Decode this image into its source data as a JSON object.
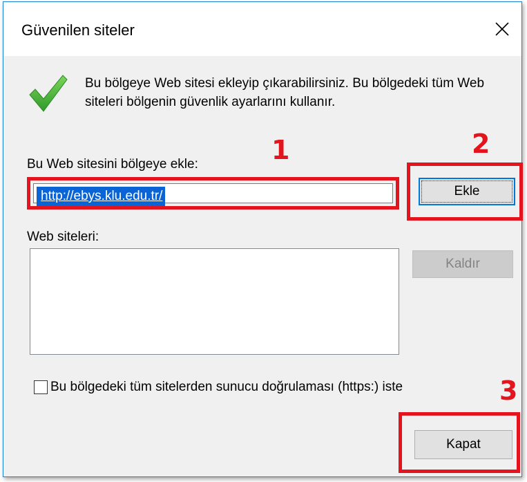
{
  "dialog": {
    "title": "Güvenilen siteler",
    "info": "Bu bölgeye Web sitesi ekleyip çıkarabilirsiniz. Bu bölgedeki tüm Web siteleri bölgenin güvenlik ayarlarını kullanır.",
    "add_label": "Bu Web sitesini bölgeye ekle:",
    "url_value": "http://ebys.klu.edu.tr/",
    "add_button": "Ekle",
    "sites_label": "Web siteleri:",
    "remove_button": "Kaldır",
    "https_checkbox_label": "Bu bölgedeki tüm sitelerden sunucu doğrulaması (https:) iste",
    "https_checked": false,
    "close_button": "Kapat"
  },
  "annotations": {
    "step1": "1",
    "step2": "2",
    "step3": "3",
    "color": "#e3141d"
  },
  "icons": {
    "check": "checkmark-icon",
    "close": "close-icon"
  }
}
